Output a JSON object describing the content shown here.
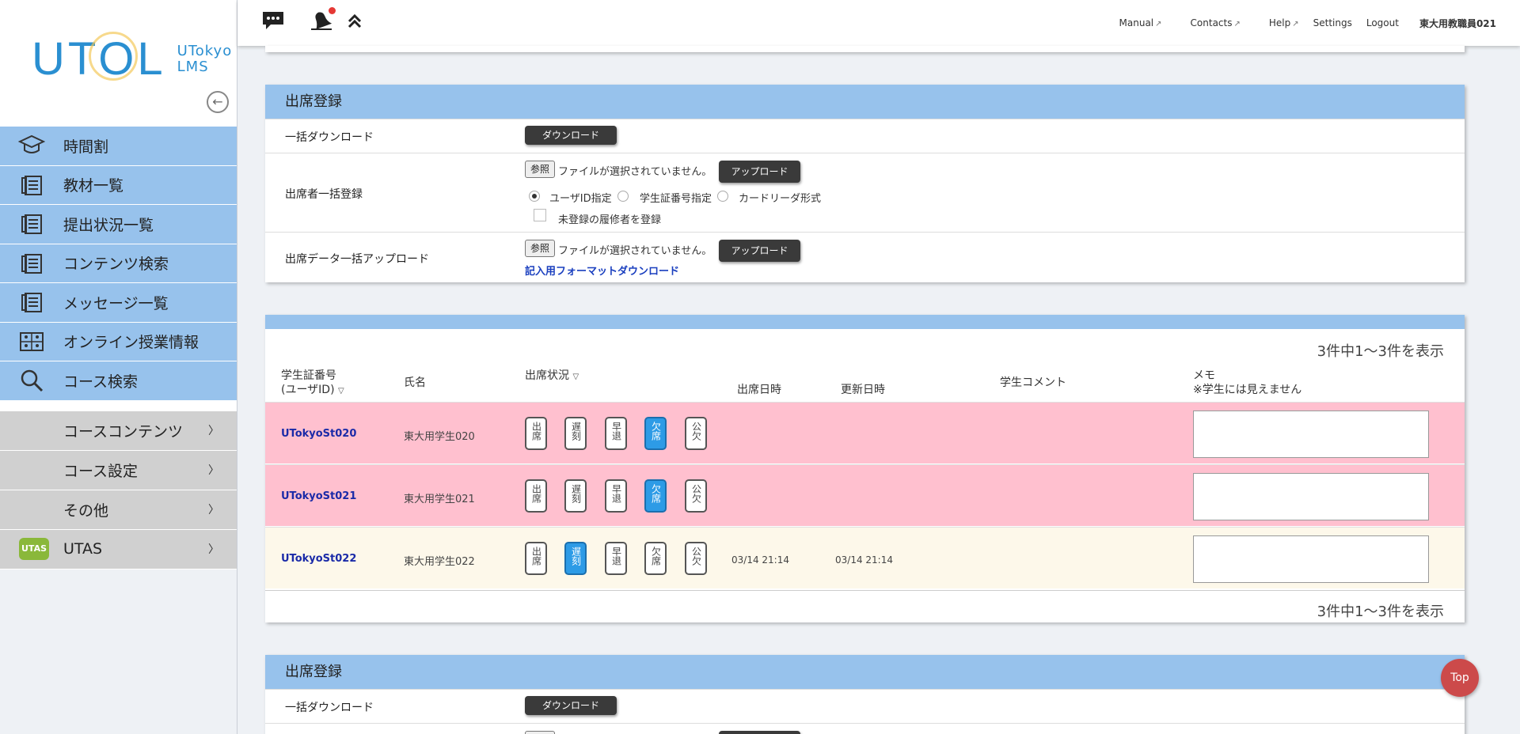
{
  "logo": {
    "main": "UTOL",
    "sub1": "UTokyo",
    "sub2": "LMS"
  },
  "sidebar": {
    "items": [
      {
        "label": "時間割",
        "icon": "mortarboard-icon"
      },
      {
        "label": "教材一覧",
        "icon": "document-icon"
      },
      {
        "label": "提出状況一覧",
        "icon": "document-icon"
      },
      {
        "label": "コンテンツ検索",
        "icon": "document-icon"
      },
      {
        "label": "メッセージ一覧",
        "icon": "document-icon"
      },
      {
        "label": "オンライン授業情報",
        "icon": "classroom-icon"
      },
      {
        "label": "コース検索",
        "icon": "search-icon"
      }
    ],
    "sub_items": [
      {
        "label": "コースコンテンツ"
      },
      {
        "label": "コース設定"
      },
      {
        "label": "その他"
      },
      {
        "label": "UTAS"
      }
    ]
  },
  "header": {
    "manual": "Manual",
    "contacts": "Contacts",
    "help": "Help",
    "settings": "Settings",
    "logout": "Logout",
    "user": "東大用教職員021"
  },
  "reg1": {
    "title": "出席登録",
    "bulk_download_label": "一括ダウンロード",
    "download_btn": "ダウンロード",
    "attendee_label": "出席者一括登録",
    "browse": "参照",
    "no_file": "ファイルが選択されていません。",
    "upload_btn": "アップロード",
    "opt_userid": "ユーザID指定",
    "opt_student": "学生証番号指定",
    "opt_card": "カードリーダ形式",
    "unregistered": "未登録の履修者を登録",
    "data_upload_label": "出席データ一括アップロード",
    "format_link": "記入用フォーマットダウンロード"
  },
  "table": {
    "count_text": "3件中1〜3件を表示",
    "col_student_id1": "学生証番号",
    "col_student_id2": "(ユーザID)",
    "col_name": "氏名",
    "col_status": "出席状況",
    "col_attend_time": "出席日時",
    "col_update_time": "更新日時",
    "col_comment": "学生コメント",
    "col_memo1": "メモ",
    "col_memo2": "※学生には見えません",
    "status_labels": [
      "出席",
      "遅刻",
      "早退",
      "欠席",
      "公欠"
    ],
    "rows": [
      {
        "id": "UTokyoSt020",
        "name": "東大用学生020",
        "selected": 3,
        "attend": "",
        "update": "",
        "bg": "#ffc0cf"
      },
      {
        "id": "UTokyoSt021",
        "name": "東大用学生021",
        "selected": 3,
        "attend": "",
        "update": "",
        "bg": "#ffc0cf"
      },
      {
        "id": "UTokyoSt022",
        "name": "東大用学生022",
        "selected": 1,
        "attend": "03/14 21:14",
        "update": "03/14 21:14",
        "bg": "#fdf8ea"
      }
    ]
  },
  "reg2": {
    "title": "出席登録",
    "bulk_download_label": "一括ダウンロード",
    "download_btn": "ダウンロード"
  },
  "top_button": "Top"
}
